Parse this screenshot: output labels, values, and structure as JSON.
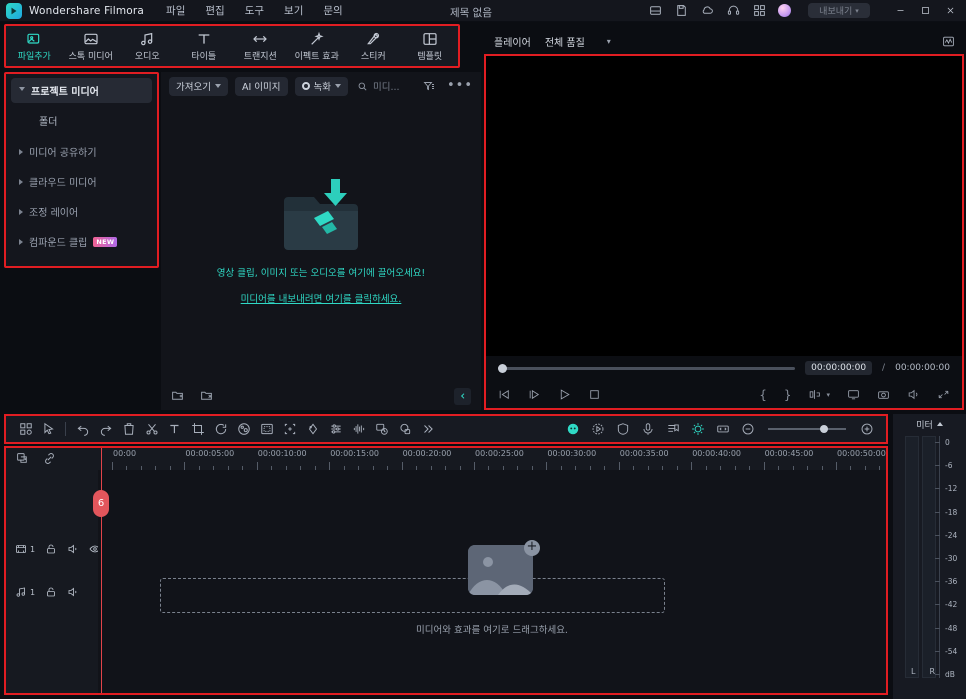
{
  "titlebar": {
    "brand": "Wondershare Filmora",
    "project_title": "제목 없음",
    "menus": [
      "파일",
      "편집",
      "도구",
      "보기",
      "문의"
    ],
    "icons": [
      "save-project-icon",
      "save-as-icon",
      "cloud-upload-icon",
      "support-headset-icon",
      "apps-grid-icon"
    ],
    "export_label": "내보내기",
    "window_buttons": [
      "minimize",
      "maximize",
      "close"
    ]
  },
  "main_toolbar": {
    "items": [
      {
        "label": "파일추가",
        "icon": "add-file-icon",
        "active": true
      },
      {
        "label": "스톡 미디어",
        "icon": "stock-media-icon",
        "active": false
      },
      {
        "label": "오디오",
        "icon": "audio-note-icon",
        "active": false
      },
      {
        "label": "타이틀",
        "icon": "title-text-icon",
        "active": false
      },
      {
        "label": "트랜지션",
        "icon": "transition-icon",
        "active": false
      },
      {
        "label": "이펙트 효과",
        "icon": "effects-wand-icon",
        "active": false
      },
      {
        "label": "스티커",
        "icon": "sticker-icon",
        "active": false
      },
      {
        "label": "템플릿",
        "icon": "template-layout-icon",
        "active": false
      }
    ]
  },
  "sidebar": {
    "items": [
      {
        "label": "프로젝트 미디어",
        "selected": true,
        "expanded": true,
        "sub": false,
        "badge": ""
      },
      {
        "label": "폴더",
        "selected": false,
        "expanded": false,
        "sub": true,
        "badge": ""
      },
      {
        "label": "미디어 공유하기",
        "selected": false,
        "expanded": false,
        "sub": false,
        "badge": ""
      },
      {
        "label": "클라우드 미디어",
        "selected": false,
        "expanded": false,
        "sub": false,
        "badge": ""
      },
      {
        "label": "조정 레이어",
        "selected": false,
        "expanded": false,
        "sub": false,
        "badge": ""
      },
      {
        "label": "컴파운드 클립",
        "selected": false,
        "expanded": false,
        "sub": false,
        "badge": "NEW"
      }
    ]
  },
  "media_panel": {
    "import_label": "가져오기",
    "ai_image_label": "AI 이미지",
    "record_label": "녹화",
    "search_placeholder": "미디...",
    "filter_icon": "filter-sort-icon",
    "more_icon": "more-options-icon",
    "dropzone_text": "영상 클립, 이미지 또는 오디오를 여기에 끌어오세요!",
    "dropzone_link": "미디어를 내보내려면 여기를 클릭하세요.",
    "footer_icons": [
      "new-folder-icon",
      "delete-folder-icon",
      "collapse-panel-icon"
    ]
  },
  "preview": {
    "player_label": "플레이어",
    "quality_label": "전체 품질",
    "scope_icon": "waveform-scope-icon",
    "current_time": "00:00:00:00",
    "separator": "/",
    "total_time": "00:00:00:00",
    "controls": [
      "prev-frame-icon",
      "next-frame-icon",
      "play-icon",
      "stop-icon"
    ],
    "right_controls": [
      "mark-in-icon",
      "mark-out-icon",
      "split-icon",
      "fullscreen-icon",
      "snapshot-icon",
      "volume-icon",
      "expand-icon"
    ]
  },
  "timeline_toolbar": {
    "left_icons": [
      "grid-view-icon",
      "selection-tool-icon",
      "undo-icon",
      "redo-icon",
      "delete-icon",
      "split-scissors-icon",
      "text-icon",
      "crop-icon",
      "rotate-icon",
      "color-palette-icon",
      "mask-icon",
      "fit-frame-icon",
      "keyframe-icon",
      "adjust-sliders-icon",
      "audio-wave-icon",
      "auto-reframe-icon",
      "motion-tracking-icon",
      "more-chevron-icon"
    ],
    "right_icons": [
      "ai-smart-icon",
      "speed-ramp-icon",
      "shield-icon",
      "voiceover-mic-icon",
      "marker-list-icon",
      "auto-sync-icon",
      "fit-timeline-icon"
    ],
    "zoom_out_icon": "zoom-out-icon",
    "zoom_in_icon": "zoom-in-icon"
  },
  "timeline": {
    "add_track_icon": "add-track-icon",
    "link_icon": "link-clips-icon",
    "tracks": [
      {
        "type": "video",
        "number": "1",
        "icons": [
          "video-track-icon",
          "lock-icon",
          "mute-icon",
          "eye-icon"
        ]
      },
      {
        "type": "audio",
        "number": "1",
        "icons": [
          "audio-track-icon",
          "lock-icon",
          "mute-icon"
        ]
      }
    ],
    "ruler_labels": [
      "00:00",
      "00:00:05:00",
      "00:00:10:00",
      "00:00:15:00",
      "00:00:20:00",
      "00:00:25:00",
      "00:00:30:00",
      "00:00:35:00",
      "00:00:40:00",
      "00:00:45:00",
      "00:00:50:00"
    ],
    "playhead_badge": "6",
    "drop_hint": "미디어와 효과를 여기로 드래그하세요."
  },
  "meter": {
    "title": "미터",
    "scale": [
      "0",
      "-6",
      "-12",
      "-18",
      "-24",
      "-30",
      "-36",
      "-42",
      "-48",
      "-54",
      "dB"
    ],
    "channels": [
      "L",
      "R"
    ]
  },
  "colors": {
    "accent_teal": "#2fd9c5",
    "highlight_red": "#e11d22",
    "panel_bg": "#171a22"
  }
}
